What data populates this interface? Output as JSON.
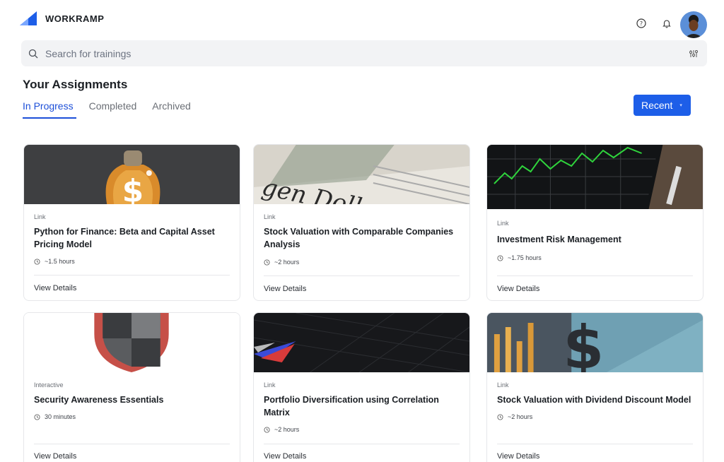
{
  "header": {
    "brand": "WORKRAMP",
    "icons": [
      "help-icon",
      "bell-icon"
    ]
  },
  "search": {
    "placeholder": "Search for trainings",
    "icon": "search-icon",
    "filter_icon": "filter-icon"
  },
  "page": {
    "title": "Your Assignments"
  },
  "tabs": [
    {
      "label": "In Progress",
      "active": true
    },
    {
      "label": "Completed",
      "active": false
    },
    {
      "label": "Archived",
      "active": false
    }
  ],
  "sort": {
    "label": "Recent",
    "caret": "▾"
  },
  "colors": {
    "accent": "#1d5ee8",
    "tab_active": "#1d4fd8"
  },
  "cards": [
    {
      "type": "Link",
      "title": "Python for Finance: Beta and Capital Asset Pricing Model",
      "duration": "~1.5 hours",
      "cta": "View Details",
      "image": "money-bag"
    },
    {
      "type": "Link",
      "title": "Stock Valuation with Comparable Companies Analysis",
      "duration": "~2 hours",
      "cta": "View Details",
      "image": "dollar-newspaper"
    },
    {
      "type": "Link",
      "title": "Investment Risk Management",
      "duration": "~1.75 hours",
      "cta": "View Details",
      "image": "stock-chart-tablet"
    },
    {
      "type": "Interactive",
      "title": "Security Awareness Essentials",
      "duration": "30 minutes",
      "cta": "View Details",
      "image": "shield"
    },
    {
      "type": "Link",
      "title": "Portfolio Diversification using Correlation Matrix",
      "duration": "~2 hours",
      "cta": "View Details",
      "image": "dark-grid-chart"
    },
    {
      "type": "Link",
      "title": "Stock Valuation with Dividend Discount Model",
      "duration": "~2 hours",
      "cta": "View Details",
      "image": "dollar-sign-chart"
    }
  ]
}
